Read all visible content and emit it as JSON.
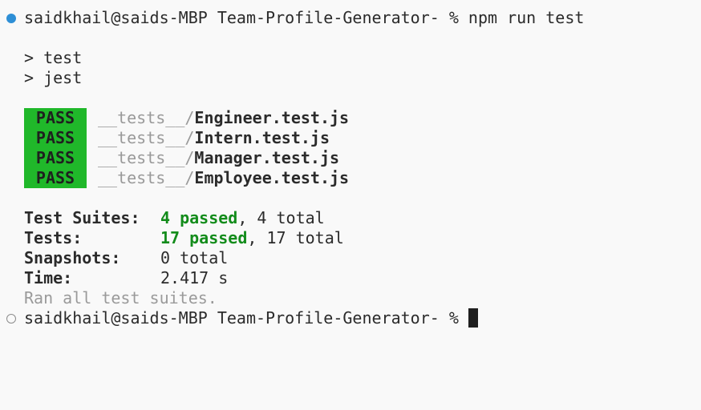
{
  "colors": {
    "blue": "#2e8fd6",
    "green_bg": "#20b82a",
    "green_text": "#138c1b"
  },
  "prompt": {
    "user_host": "saidkhail@saids-MBP",
    "dir": "Team-Profile-Generator-",
    "symbol": "%",
    "command": "npm run test"
  },
  "script_lines": [
    "> test",
    "> jest"
  ],
  "results": [
    {
      "status": "PASS",
      "dir": "__tests__/",
      "file": "Engineer.test.js"
    },
    {
      "status": "PASS",
      "dir": "__tests__/",
      "file": "Intern.test.js"
    },
    {
      "status": "PASS",
      "dir": "__tests__/",
      "file": "Manager.test.js"
    },
    {
      "status": "PASS",
      "dir": "__tests__/",
      "file": "Employee.test.js"
    }
  ],
  "summary": {
    "suites": {
      "label": "Test Suites:",
      "passed": "4 passed",
      "rest": ", 4 total"
    },
    "tests": {
      "label": "Tests:",
      "passed": "17 passed",
      "rest": ", 17 total"
    },
    "snapshots": {
      "label": "Snapshots:",
      "value": "0 total"
    },
    "time": {
      "label": "Time:",
      "value": "2.417 s"
    },
    "ran": "Ran all test suites."
  }
}
